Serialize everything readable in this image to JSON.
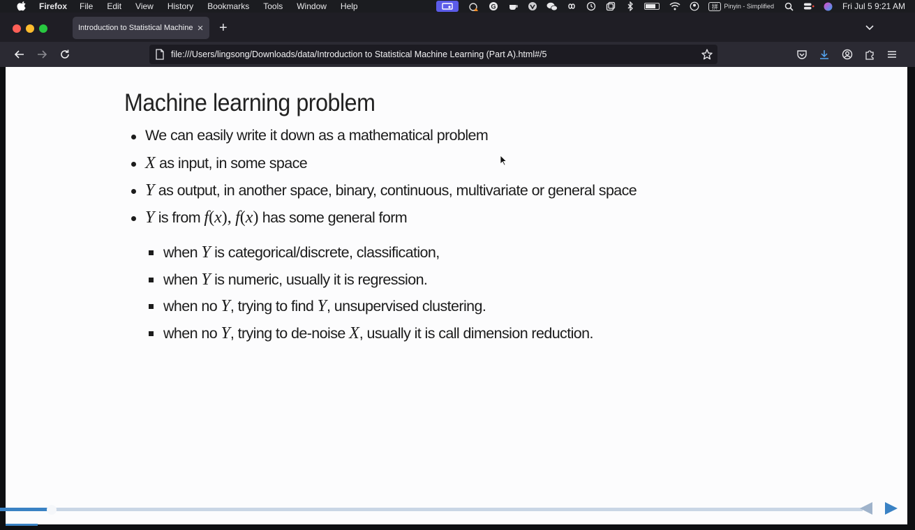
{
  "menubar": {
    "app_name": "Firefox",
    "items": [
      "File",
      "Edit",
      "View",
      "History",
      "Bookmarks",
      "Tools",
      "Window",
      "Help"
    ],
    "input_method_label": "Pinyin - Simplified",
    "input_method_box": "拼",
    "clock": "Fri Jul 5  9:21 AM"
  },
  "browser": {
    "tab_title": "Introduction to Statistical Machine L",
    "tab_close": "×",
    "new_tab": "+",
    "url": "file:///Users/lingsong/Downloads/data/Introduction to Statistical Machine Learning (Part A).html#/5"
  },
  "slide": {
    "title": "Machine learning problem",
    "bullets": [
      {
        "pre": "We can easily write it down as a mathematical problem"
      },
      {
        "var": "X",
        "text": " as input, in some space"
      },
      {
        "var": "Y",
        "text": " as output, in another space, binary, continuous, multivariate or general space"
      },
      {
        "var": "Y",
        "text": " is from ",
        "fx1": "f",
        "paren1": "(",
        "x1": "x",
        "paren1c": "),",
        "fx2": "f",
        "paren2": "(",
        "x2": "x",
        "paren2c": ")",
        "tail": " has some general form"
      }
    ],
    "sub_bullets": [
      {
        "pre": "when ",
        "var": "Y",
        "text": " is categorical/discrete, classification,"
      },
      {
        "pre": "when ",
        "var": "Y",
        "text": " is numeric, usually it is regression."
      },
      {
        "pre": "when no ",
        "var": "Y",
        "mid": ", trying to find ",
        "var2": "Y",
        "text": ", unsupervised clustering."
      },
      {
        "pre": "when no ",
        "var": "Y",
        "mid": ", trying to de-noise ",
        "var2": "X",
        "text": ", usually it is call dimension reduction."
      }
    ]
  },
  "progress": {
    "fraction": 0.06
  },
  "colors": {
    "menubar_bg": "#1b1c20",
    "tabstrip_bg": "#1f1e25",
    "navbar_bg": "#2b2a33",
    "urlbar_bg": "#1c1b22",
    "slide_bg": "#fcfcfd",
    "accent": "#3a82c4"
  }
}
